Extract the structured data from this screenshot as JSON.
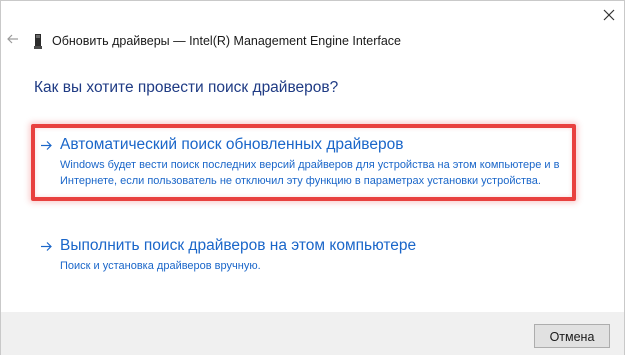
{
  "window": {
    "title": "Обновить драйверы — Intel(R) Management Engine Interface",
    "back_icon": "back-arrow-icon",
    "device_icon": "device-icon",
    "close_icon": "close-icon"
  },
  "main": {
    "heading": "Как вы хотите провести поиск драйверов?",
    "options": [
      {
        "title": "Автоматический поиск обновленных драйверов",
        "description_line1": "Windows будет вести поиск последних версий драйверов для устройства на этом компьютере и в",
        "description_line2": "Интернете, если пользователь не отключил эту функцию в параметрах установки устройства.",
        "icon": "arrow-right-icon",
        "highlighted": true
      },
      {
        "title": "Выполнить поиск драйверов на этом компьютере",
        "description_line1": "Поиск и установка драйверов вручную.",
        "icon": "arrow-right-icon",
        "highlighted": false
      }
    ]
  },
  "footer": {
    "cancel_label": "Отмена"
  },
  "colors": {
    "heading": "#1f3b84",
    "link": "#1a66c9",
    "highlight": "#e8413f",
    "footer_bg": "#f0f0f0"
  }
}
